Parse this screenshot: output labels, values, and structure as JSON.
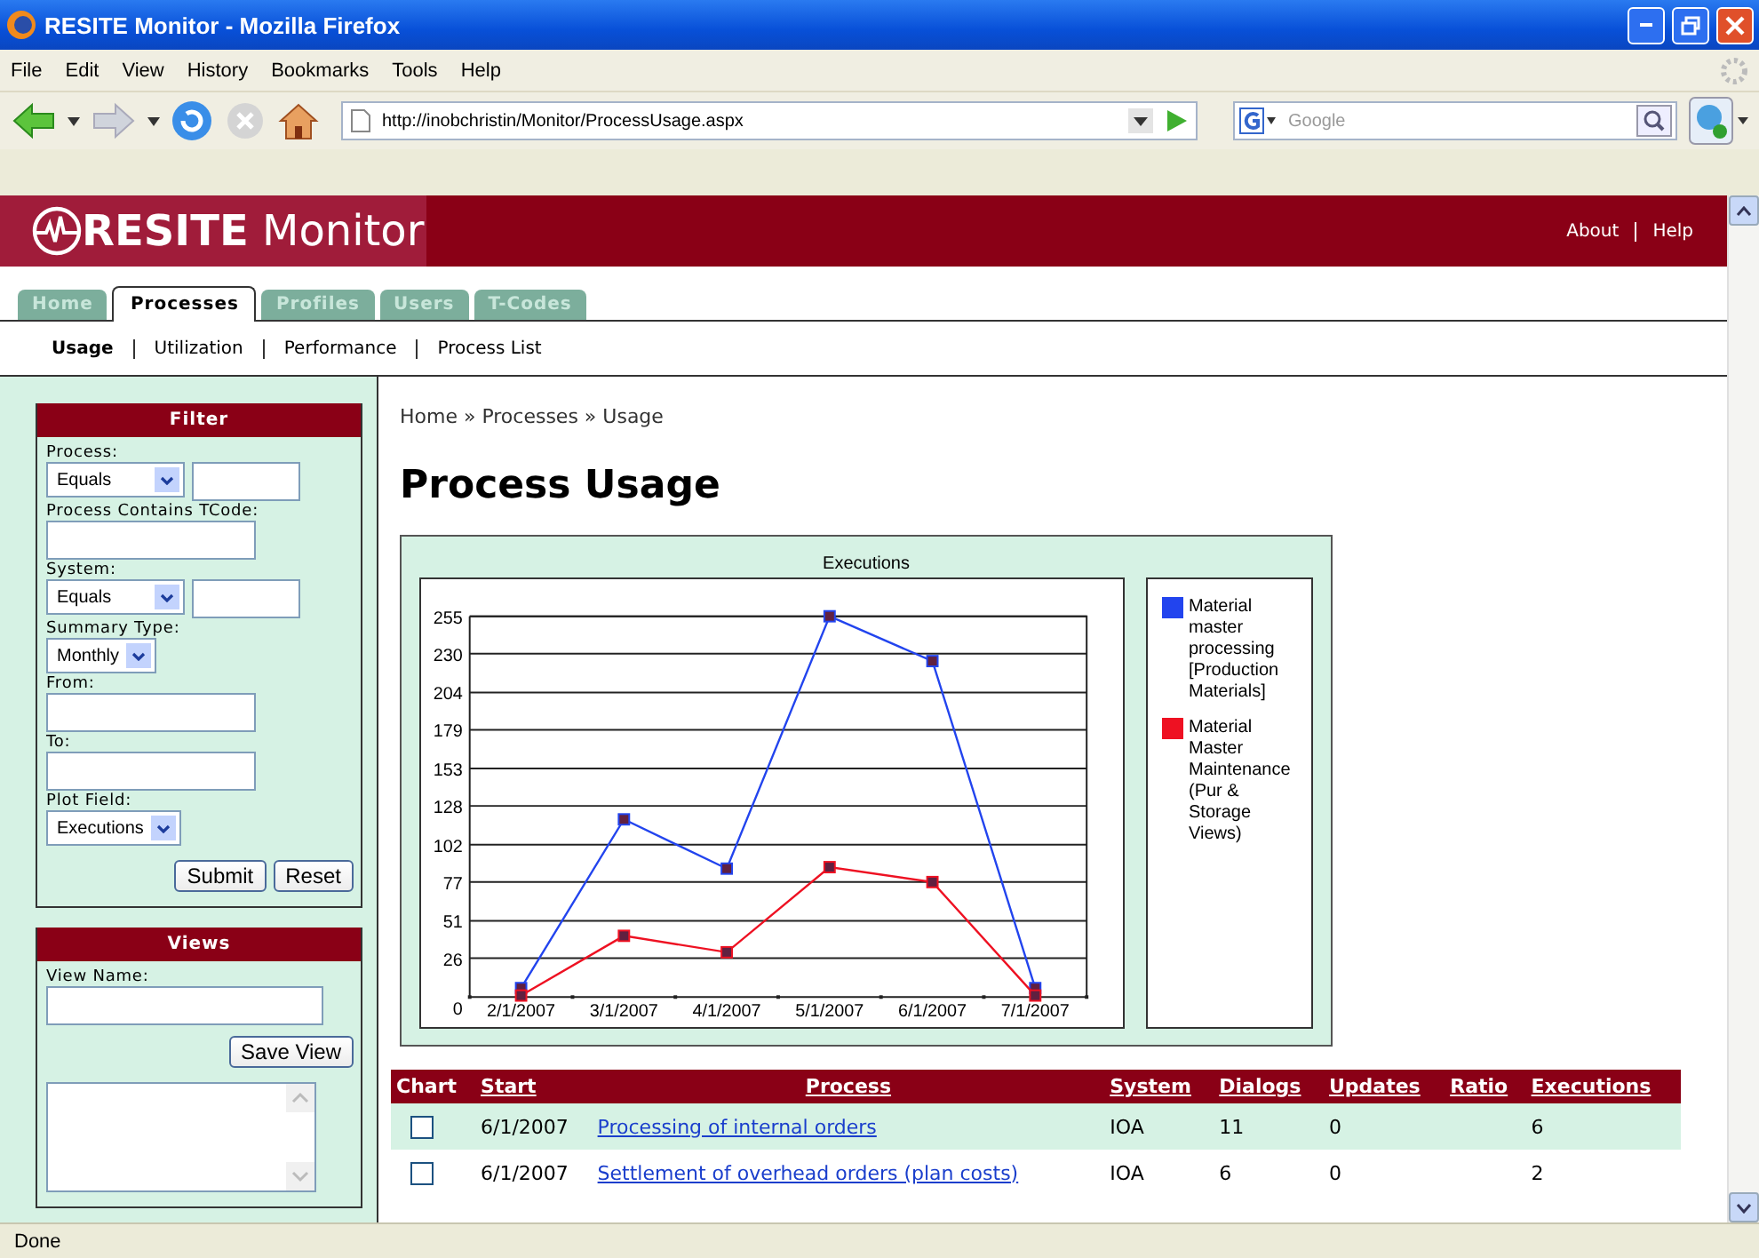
{
  "window": {
    "title": "RESITE Monitor - Mozilla Firefox"
  },
  "menu": [
    "File",
    "Edit",
    "View",
    "History",
    "Bookmarks",
    "Tools",
    "Help"
  ],
  "address_bar": {
    "value": "http://inobchristin/Monitor/ProcessUsage.aspx"
  },
  "search": {
    "placeholder": "Google"
  },
  "site": {
    "logo": "RESITE Monitor",
    "links": [
      "About",
      "Help"
    ]
  },
  "tabs": [
    {
      "label": "Home",
      "selected": false
    },
    {
      "label": "Processes",
      "selected": true
    },
    {
      "label": "Profiles",
      "selected": false
    },
    {
      "label": "Users",
      "selected": false
    },
    {
      "label": "T-Codes",
      "selected": false
    }
  ],
  "subnav": [
    {
      "label": "Usage",
      "selected": true
    },
    {
      "label": "Utilization",
      "selected": false
    },
    {
      "label": "Performance",
      "selected": false
    },
    {
      "label": "Process List",
      "selected": false
    }
  ],
  "filter": {
    "title": "Filter",
    "fields": [
      {
        "kind": "select-text",
        "label": "Process:",
        "select": "Equals"
      },
      {
        "kind": "text",
        "label": "Process Contains TCode:"
      },
      {
        "kind": "select-text",
        "label": "System:",
        "select": "Equals"
      },
      {
        "kind": "select",
        "label": "Summary Type:",
        "select": "Monthly"
      },
      {
        "kind": "text",
        "label": "From:"
      },
      {
        "kind": "text",
        "label": "To:"
      },
      {
        "kind": "select",
        "label": "Plot Field:",
        "select": "Executions"
      }
    ],
    "buttons": [
      "Submit",
      "Reset"
    ]
  },
  "views": {
    "title": "Views",
    "label": "View Name:",
    "button": "Save View"
  },
  "breadcrumb": "Home » Processes » Usage",
  "heading": "Process Usage",
  "chart_data": {
    "type": "line",
    "title": "Executions",
    "categories": [
      "2/1/2007",
      "3/1/2007",
      "4/1/2007",
      "5/1/2007",
      "6/1/2007",
      "7/1/2007"
    ],
    "ylim": [
      0,
      255
    ],
    "grid": true,
    "legend": true,
    "yticks": [
      0,
      26,
      51,
      77,
      102,
      128,
      153,
      179,
      204,
      230,
      255
    ],
    "series": [
      {
        "name": "Material master processing [Production Materials]",
        "color": "#2244ee",
        "marker": "square",
        "values": [
          6,
          119,
          86,
          255,
          225,
          6
        ]
      },
      {
        "name": "Material Master Maintenance (Pur & Storage Views)",
        "color": "#ee1122",
        "marker": "square",
        "values": [
          1,
          41,
          30,
          87,
          77,
          1
        ]
      }
    ]
  },
  "table": {
    "columns": [
      "Chart",
      "Start",
      "Process",
      "System",
      "Dialogs",
      "Updates",
      "Ratio",
      "Executions"
    ],
    "rows": [
      {
        "checked": false,
        "start": "6/1/2007",
        "process": "Processing of internal orders",
        "system": "IOA",
        "dialogs": "11",
        "updates": "0",
        "executions": "6"
      },
      {
        "checked": false,
        "start": "6/1/2007",
        "process": "Settlement of overhead orders (plan costs)",
        "system": "IOA",
        "dialogs": "6",
        "updates": "0",
        "executions": "2"
      }
    ]
  },
  "status_bar": "Done"
}
